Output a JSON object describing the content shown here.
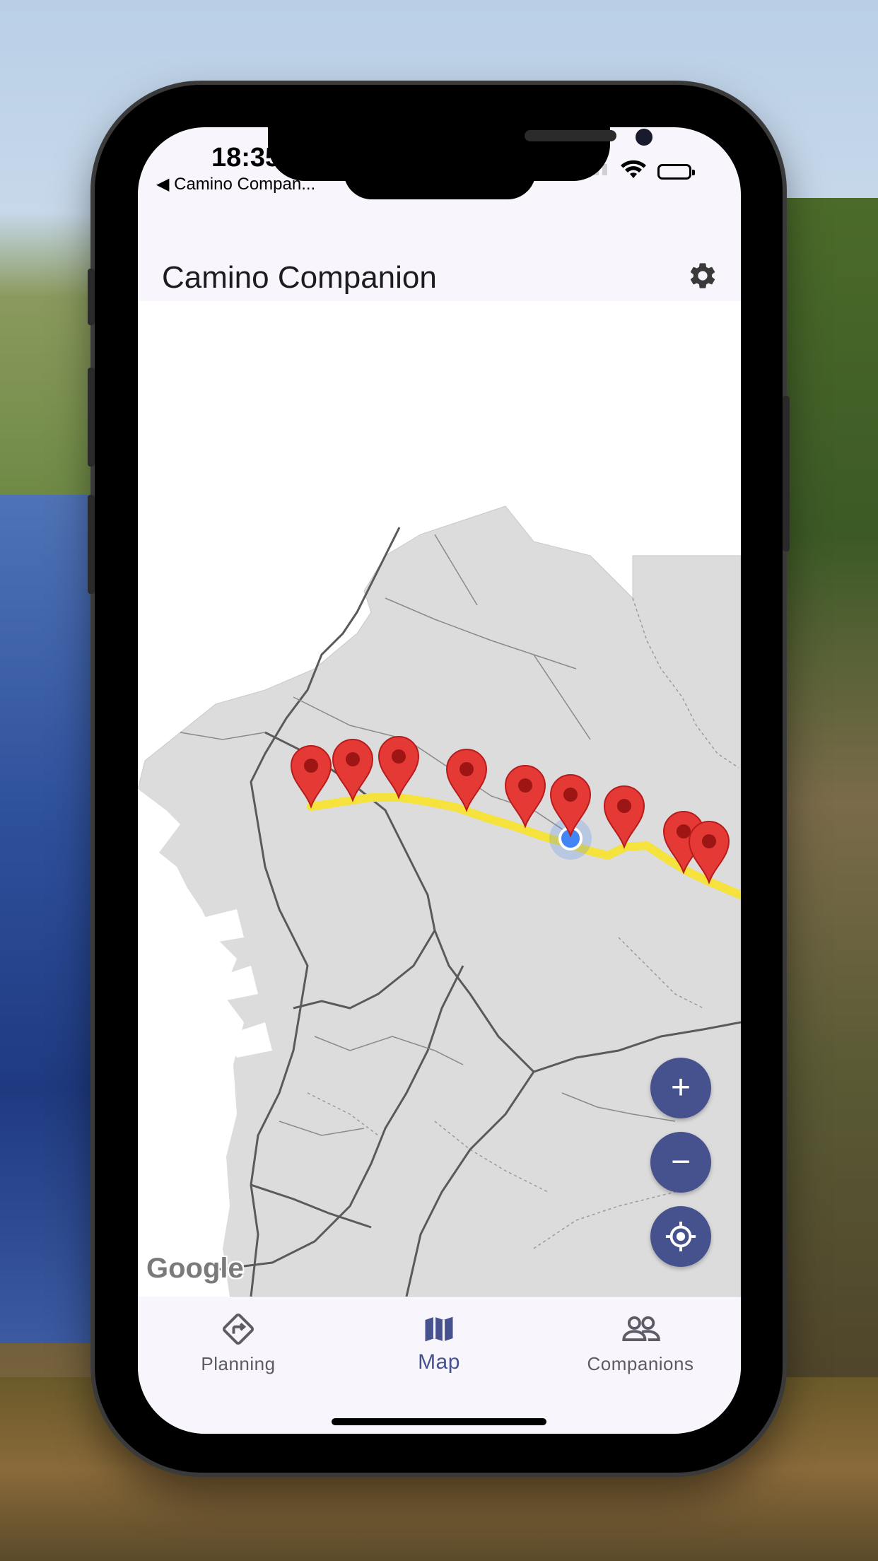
{
  "status_bar": {
    "time": "18:35",
    "back_app": "◀ Camino Compan..."
  },
  "app_bar": {
    "title": "Camino Companion"
  },
  "map": {
    "attribution": "Google",
    "route_color": "#f6e23c",
    "marker_color": "#e53935",
    "marker_count": 9
  },
  "map_controls": {
    "zoom_in": "+",
    "zoom_out": "−"
  },
  "bottom_nav": {
    "items": [
      {
        "label": "Planning",
        "icon": "directions-sign-icon",
        "active": false
      },
      {
        "label": "Map",
        "icon": "map-icon",
        "active": true
      },
      {
        "label": "Companions",
        "icon": "people-icon",
        "active": false
      }
    ]
  },
  "colors": {
    "primary": "#46528e",
    "surface": "#f8f5fc",
    "land": "#dcdcdc"
  }
}
